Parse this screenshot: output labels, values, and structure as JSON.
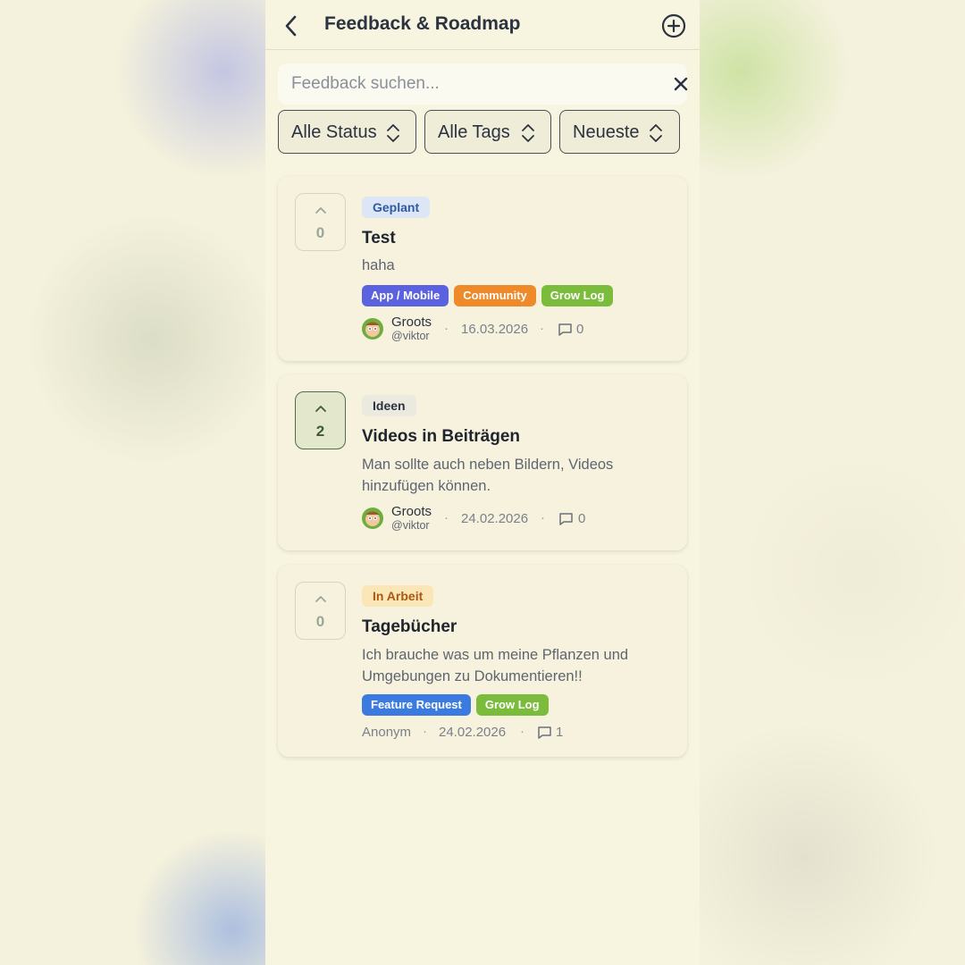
{
  "header": {
    "title": "Feedback & Roadmap",
    "back_icon": "chevron-left-icon",
    "add_icon": "plus-circle-icon"
  },
  "search": {
    "placeholder": "Feedback suchen...",
    "value": "",
    "clear_icon": "close-icon"
  },
  "filters": {
    "status": "Alle Status",
    "tags": "Alle Tags",
    "sort": "Neueste"
  },
  "colors": {
    "geplant_bg": "#dde6f5",
    "geplant_fg": "#2f5aa8",
    "ideen_bg": "#ebeadf",
    "ideen_fg": "#2b3240",
    "inarbeit_bg": "#fbe6b8",
    "inarbeit_fg": "#a85a10",
    "tag_app_mobile": "#5a62e0",
    "tag_community": "#ee8a2a",
    "tag_grow_log": "#7cbc3c",
    "tag_feature_request": "#3b7be0"
  },
  "posts": [
    {
      "votes": "0",
      "voted": false,
      "status": "Geplant",
      "title": "Test",
      "description": "haha",
      "tags": [
        "App / Mobile",
        "Community",
        "Grow Log"
      ],
      "author_name": "Groots",
      "author_handle": "@viktor",
      "date": "16.03.2026",
      "comments": "0"
    },
    {
      "votes": "2",
      "voted": true,
      "status": "Ideen",
      "title": "Videos in Beiträgen",
      "description": "Man sollte auch neben Bildern, Videos hinzufügen können.",
      "tags": [],
      "author_name": "Groots",
      "author_handle": "@viktor",
      "date": "24.02.2026",
      "comments": "0"
    },
    {
      "votes": "0",
      "voted": false,
      "status": "In Arbeit",
      "title": "Tagebücher",
      "description": "Ich brauche was um meine Pflanzen und Umgebungen zu Dokumentieren!!",
      "tags": [
        "Feature Request",
        "Grow Log"
      ],
      "author_name": "Anonym",
      "author_handle": "",
      "date": "24.02.2026",
      "comments": "1"
    }
  ]
}
